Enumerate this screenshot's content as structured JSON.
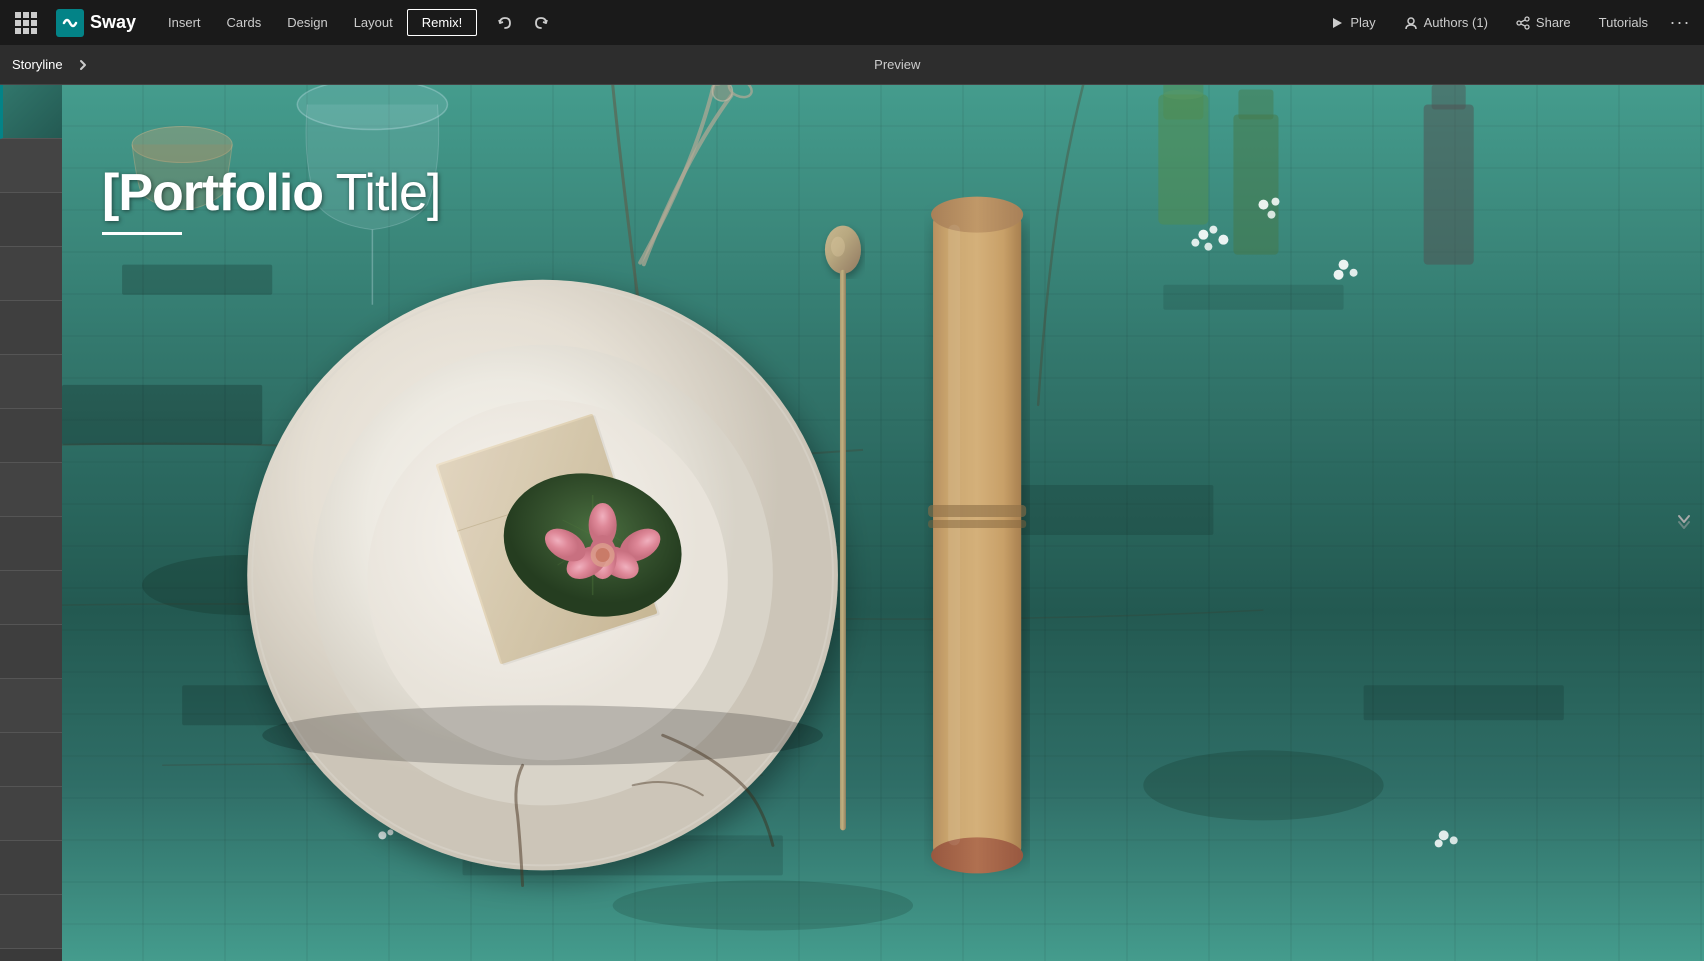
{
  "app": {
    "logo_text": "Sway",
    "logo_letter": "S"
  },
  "navbar": {
    "insert_label": "Insert",
    "cards_label": "Cards",
    "design_label": "Design",
    "layout_label": "Layout",
    "remix_label": "Remix!",
    "play_label": "Play",
    "authors_label": "Authors (1)",
    "share_label": "Share",
    "tutorials_label": "Tutorials"
  },
  "storyline": {
    "label": "Storyline",
    "preview_label": "Preview"
  },
  "canvas": {
    "portfolio_title_bold": "[Portfolio",
    "portfolio_title_light": "Title]",
    "title_underline": ""
  },
  "sidebar": {
    "thumbnails": [
      {
        "id": 1,
        "active": true
      },
      {
        "id": 2
      },
      {
        "id": 3
      },
      {
        "id": 4
      },
      {
        "id": 5
      },
      {
        "id": 6
      },
      {
        "id": 7
      },
      {
        "id": 8
      },
      {
        "id": 9
      },
      {
        "id": 10
      },
      {
        "id": 11
      },
      {
        "id": 12
      },
      {
        "id": 13
      },
      {
        "id": 14
      },
      {
        "id": 15
      },
      {
        "id": 16
      }
    ]
  },
  "colors": {
    "teal": "#038387",
    "dark_bg": "#1a1a1a",
    "sidebar_bg": "#3a3a3a"
  }
}
